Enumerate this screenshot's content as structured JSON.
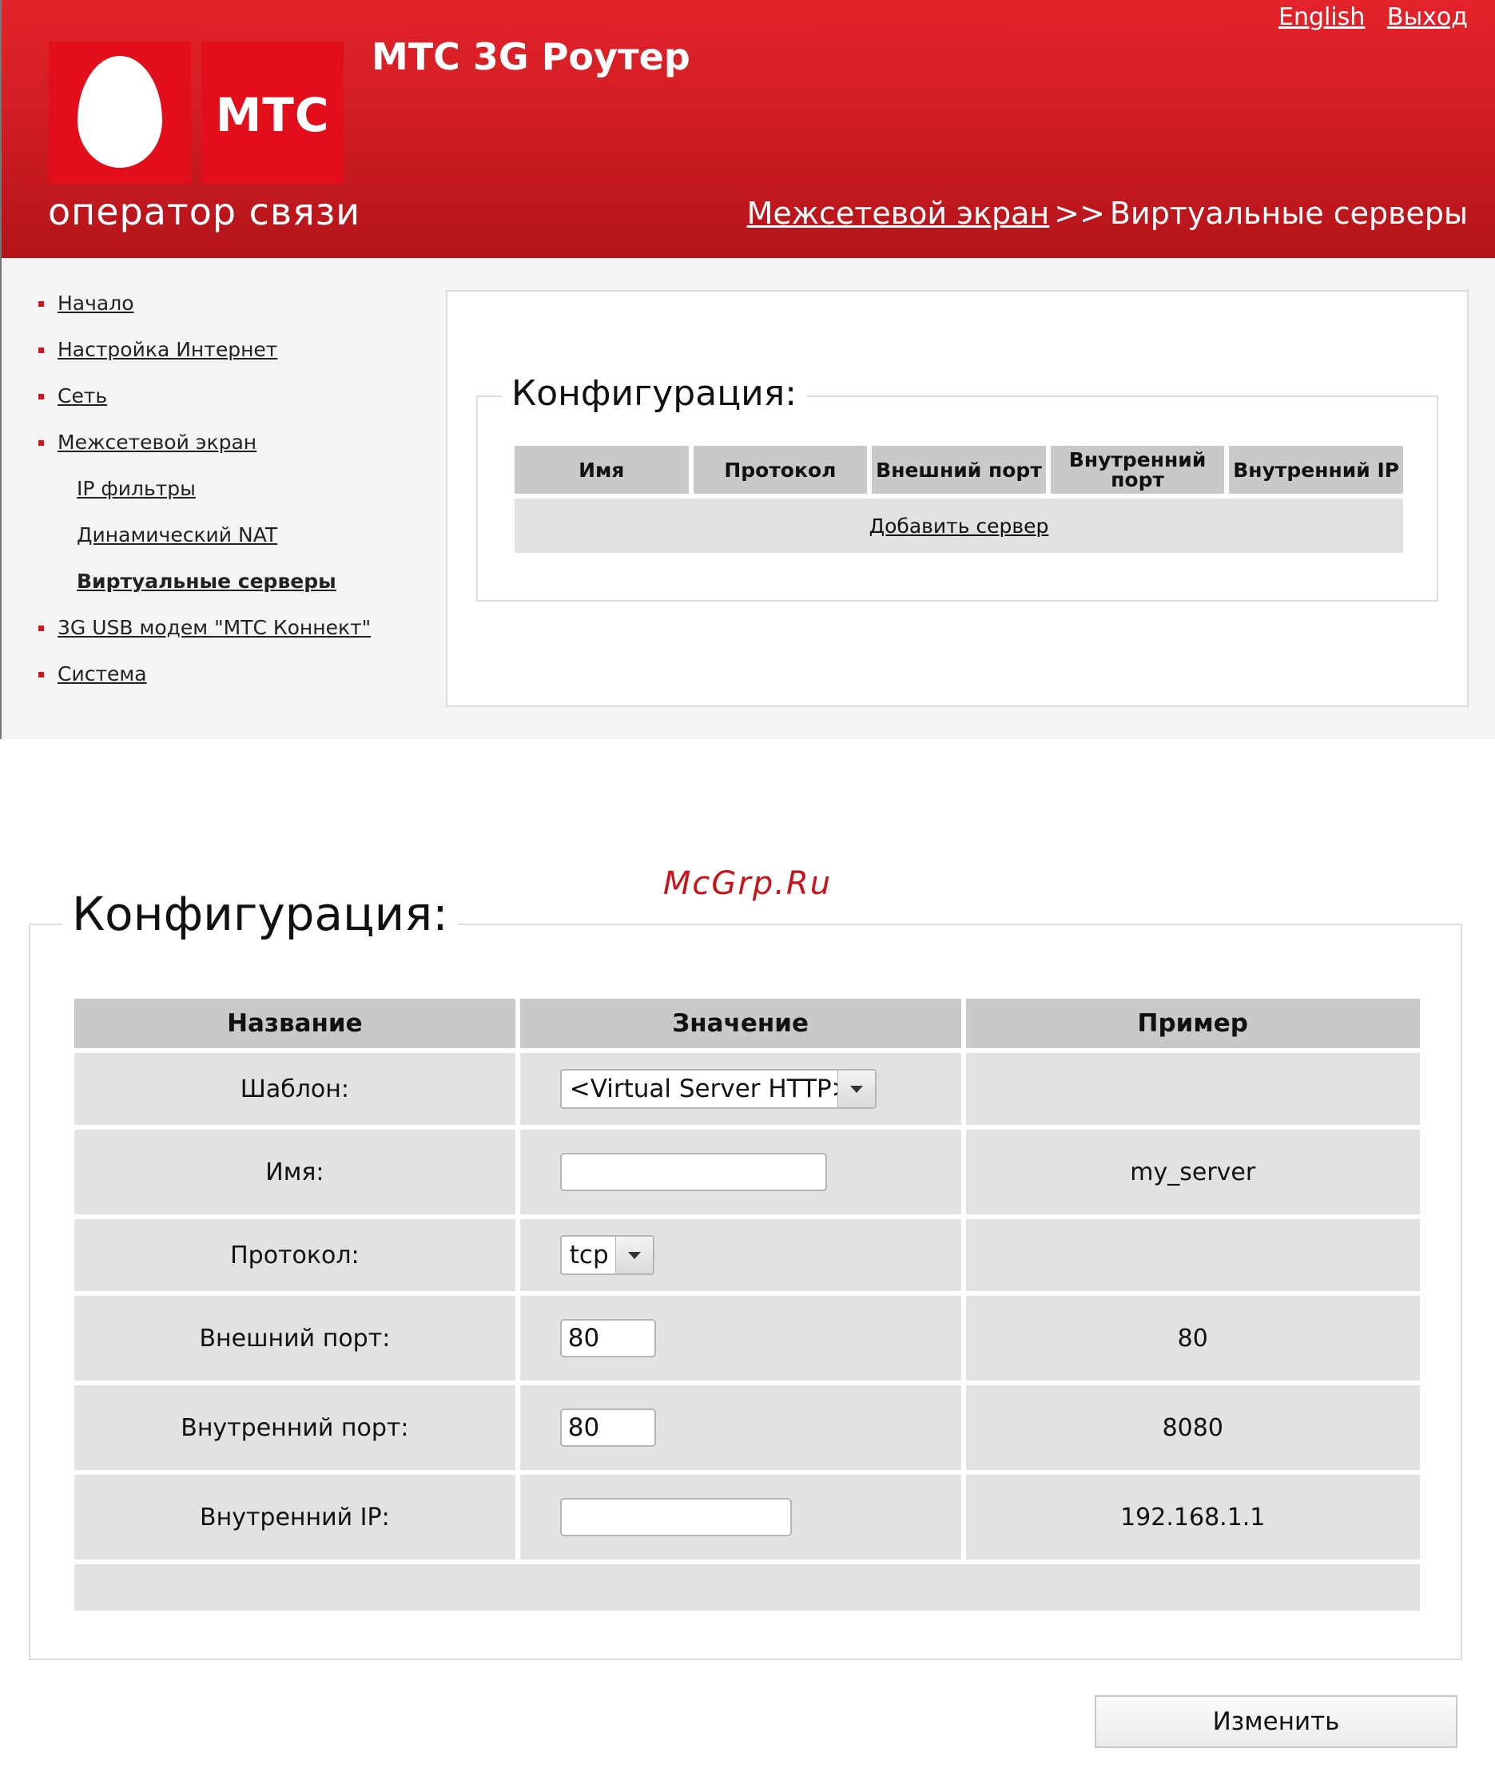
{
  "header": {
    "logo_text": "МТС",
    "tagline": "оператор связи",
    "product_title": "МТС 3G Роутер",
    "links": {
      "english": "English",
      "logout": "Выход"
    },
    "breadcrumb": {
      "parent": "Межсетевой экран",
      "separator": ">>",
      "current": "Виртуальные серверы"
    },
    "colors": {
      "brand_red": "#e20f1b",
      "header_dark": "#b3141a"
    }
  },
  "sidebar": {
    "items": [
      {
        "label": "Начало",
        "level": 1
      },
      {
        "label": "Настройка Интернет",
        "level": 1
      },
      {
        "label": "Сеть",
        "level": 1
      },
      {
        "label": "Межсетевой экран",
        "level": 1
      },
      {
        "label": "IP фильтры",
        "level": 2
      },
      {
        "label": "Динамический NAT",
        "level": 2
      },
      {
        "label": "Виртуальные серверы",
        "level": 2,
        "active": true
      },
      {
        "label": "3G USB модем \"МТС Коннект\"",
        "level": 1
      },
      {
        "label": "Система",
        "level": 1
      }
    ]
  },
  "servers_panel": {
    "legend": "Конфигурация:",
    "columns": [
      "Имя",
      "Протокол",
      "Внешний порт",
      "Внутренний порт",
      "Внутренний IP"
    ],
    "add_link": "Добавить сервер"
  },
  "watermark": "McGrp.Ru",
  "form": {
    "legend": "Конфигурация:",
    "columns": [
      "Название",
      "Значение",
      "Пример"
    ],
    "rows": {
      "template": {
        "label": "Шаблон:",
        "value": "<Virtual Server HTTP>",
        "example": ""
      },
      "name": {
        "label": "Имя:",
        "value": "",
        "example": "my_server"
      },
      "protocol": {
        "label": "Протокол:",
        "value": "tcp",
        "example": ""
      },
      "ext_port": {
        "label": "Внешний порт:",
        "value": "80",
        "example": "80"
      },
      "int_port": {
        "label": "Внутренний порт:",
        "value": "80",
        "example": "8080"
      },
      "int_ip": {
        "label": "Внутренний IP:",
        "value": "",
        "example": "192.168.1.1"
      }
    },
    "apply_label": "Изменить"
  }
}
